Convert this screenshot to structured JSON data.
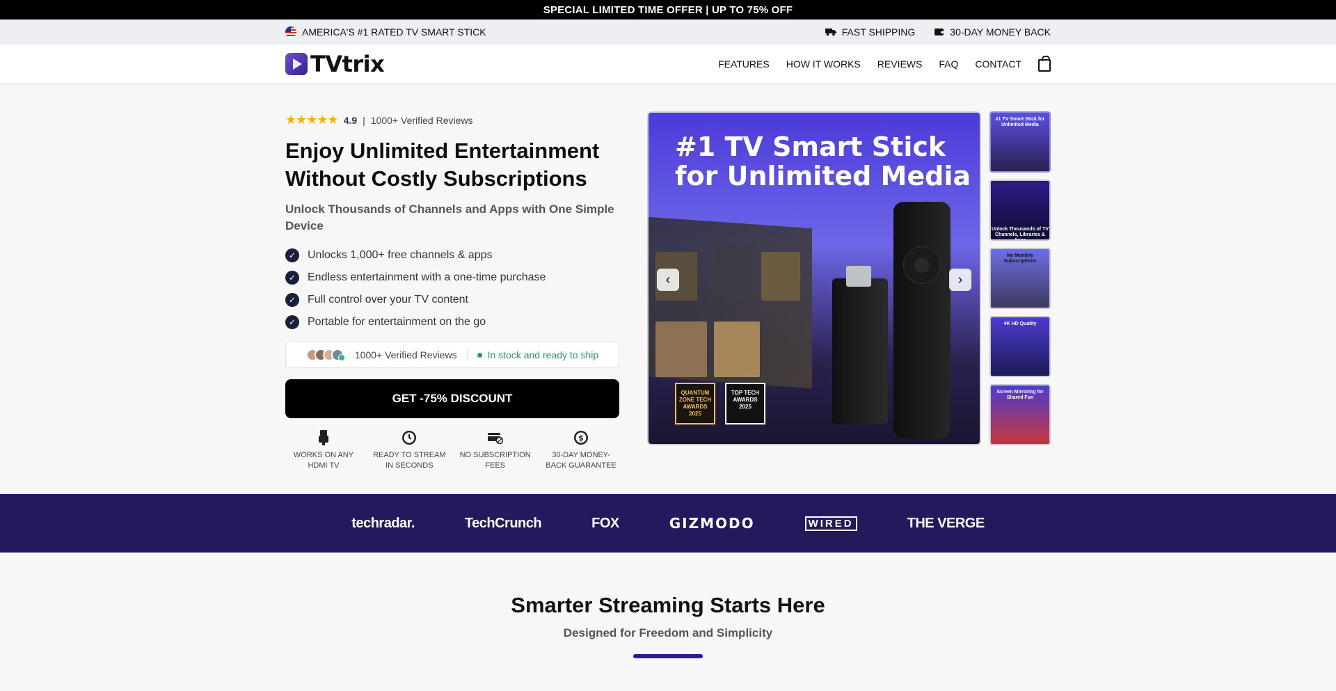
{
  "promo": {
    "text": "SPECIAL LIMITED TIME OFFER | UP TO 75% OFF"
  },
  "info_bar": {
    "left": "AMERICA'S #1 RATED TV SMART STICK",
    "right": [
      "FAST SHIPPING",
      "30-DAY MONEY BACK"
    ]
  },
  "header": {
    "logo": "TVtrix",
    "nav": [
      "FEATURES",
      "HOW IT WORKS",
      "REVIEWS",
      "FAQ",
      "CONTACT"
    ]
  },
  "hero": {
    "stars": "★★★★★",
    "rating": "4.9",
    "separator": "|",
    "reviews": "1000+ Verified Reviews",
    "title_line1": "Enjoy Unlimited Entertainment",
    "title_line2": "Without Costly Subscriptions",
    "subtitle": "Unlock Thousands of Channels and Apps with One Simple Device",
    "features": [
      "Unlocks 1,000+ free channels & apps",
      "Endless entertainment with a one-time purchase",
      "Full control over your TV content",
      "Portable for entertainment on the go"
    ],
    "proof_reviews": "1000+ Verified Reviews",
    "stock": "In stock and ready to ship",
    "cta": "GET -75% DISCOUNT",
    "badges": [
      {
        "line1": "WORKS ON ANY",
        "line2": "HDMI TV"
      },
      {
        "line1": "READY TO STREAM",
        "line2": "IN SECONDS"
      },
      {
        "line1": "NO SUBSCRIPTION",
        "line2": "FEES"
      },
      {
        "line1": "30-DAY MONEY-",
        "line2": "BACK GUARANTEE"
      }
    ]
  },
  "gallery": {
    "main_line1": "#1 TV Smart Stick",
    "main_line2": "for Unlimited Media",
    "award1": "QUANTUM ZONE TECH AWARDS 2025",
    "award2": "TOP TECH AWARDS 2025",
    "prev": "‹",
    "next": "›",
    "thumbs": [
      "#1 TV Smart Stick for Unlimited Media",
      "Unlock Thousands of TV Channels, Libraries & Apps",
      "No Monthly Subscriptions",
      "4K HD Quality",
      "Screen Mirroring for Shared Fun"
    ]
  },
  "press": [
    "techradar.",
    "TechCrunch",
    "FOX",
    "GIZMODO",
    "WIRED",
    "THE VERGE"
  ],
  "section": {
    "title": "Smarter Streaming Starts Here",
    "subtitle": "Designed for Freedom and Simplicity"
  },
  "colors": {
    "accent": "#221a5c",
    "stock_green": "#2e9a5d",
    "star": "#f5b301"
  }
}
